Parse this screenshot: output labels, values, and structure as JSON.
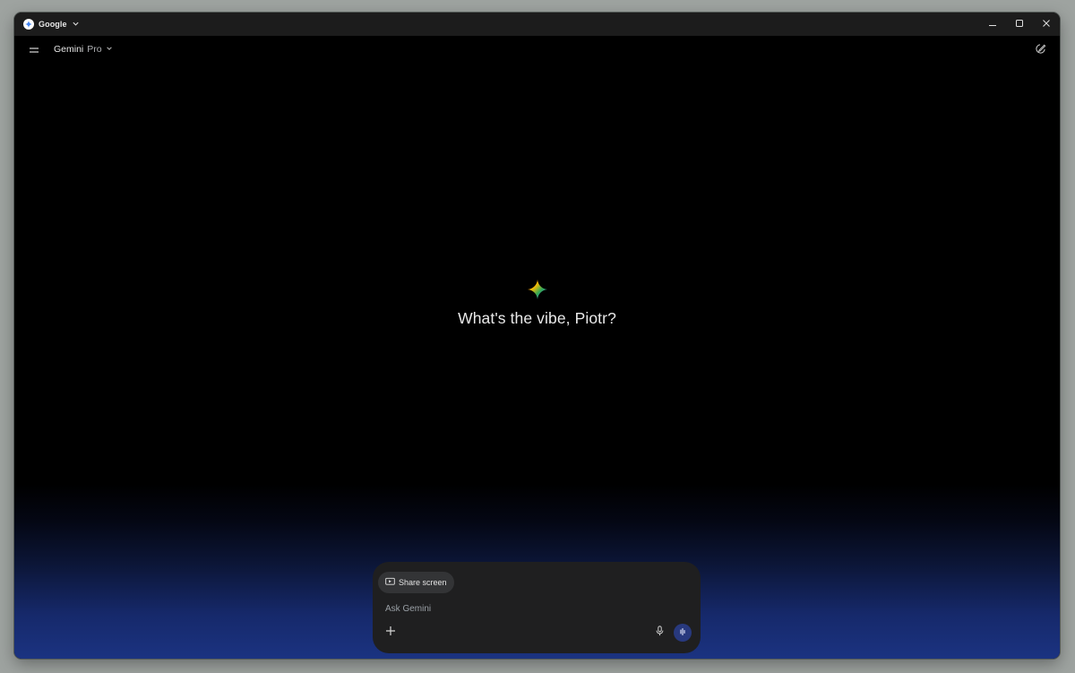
{
  "window": {
    "app_name": "Google",
    "icons": {
      "app_logo": "google-gemini-logo",
      "app_dropdown": "chevron-down-icon",
      "minimize": "minimize-icon",
      "maximize": "maximize-icon",
      "close": "close-icon"
    }
  },
  "header": {
    "menu_icon": "menu-icon",
    "model_name": "Gemini",
    "model_variant": "Pro",
    "model_dropdown_icon": "chevron-down-icon",
    "new_chat_icon": "edit-icon"
  },
  "main": {
    "logo_icon": "gemini-spark-icon",
    "greeting": "What's the vibe, Piotr?"
  },
  "composer": {
    "share_screen_label": "Share screen",
    "share_screen_icon": "screen-share-icon",
    "placeholder": "Ask Gemini",
    "add_icon": "plus-icon",
    "mic_icon": "microphone-icon",
    "live_icon": "live-audio-icon"
  },
  "colors": {
    "background": "#000000",
    "gradient_bottom": "#1b3381",
    "composer_bg": "#1f1f20",
    "chip_bg": "#333436",
    "live_button": "#28397e"
  }
}
